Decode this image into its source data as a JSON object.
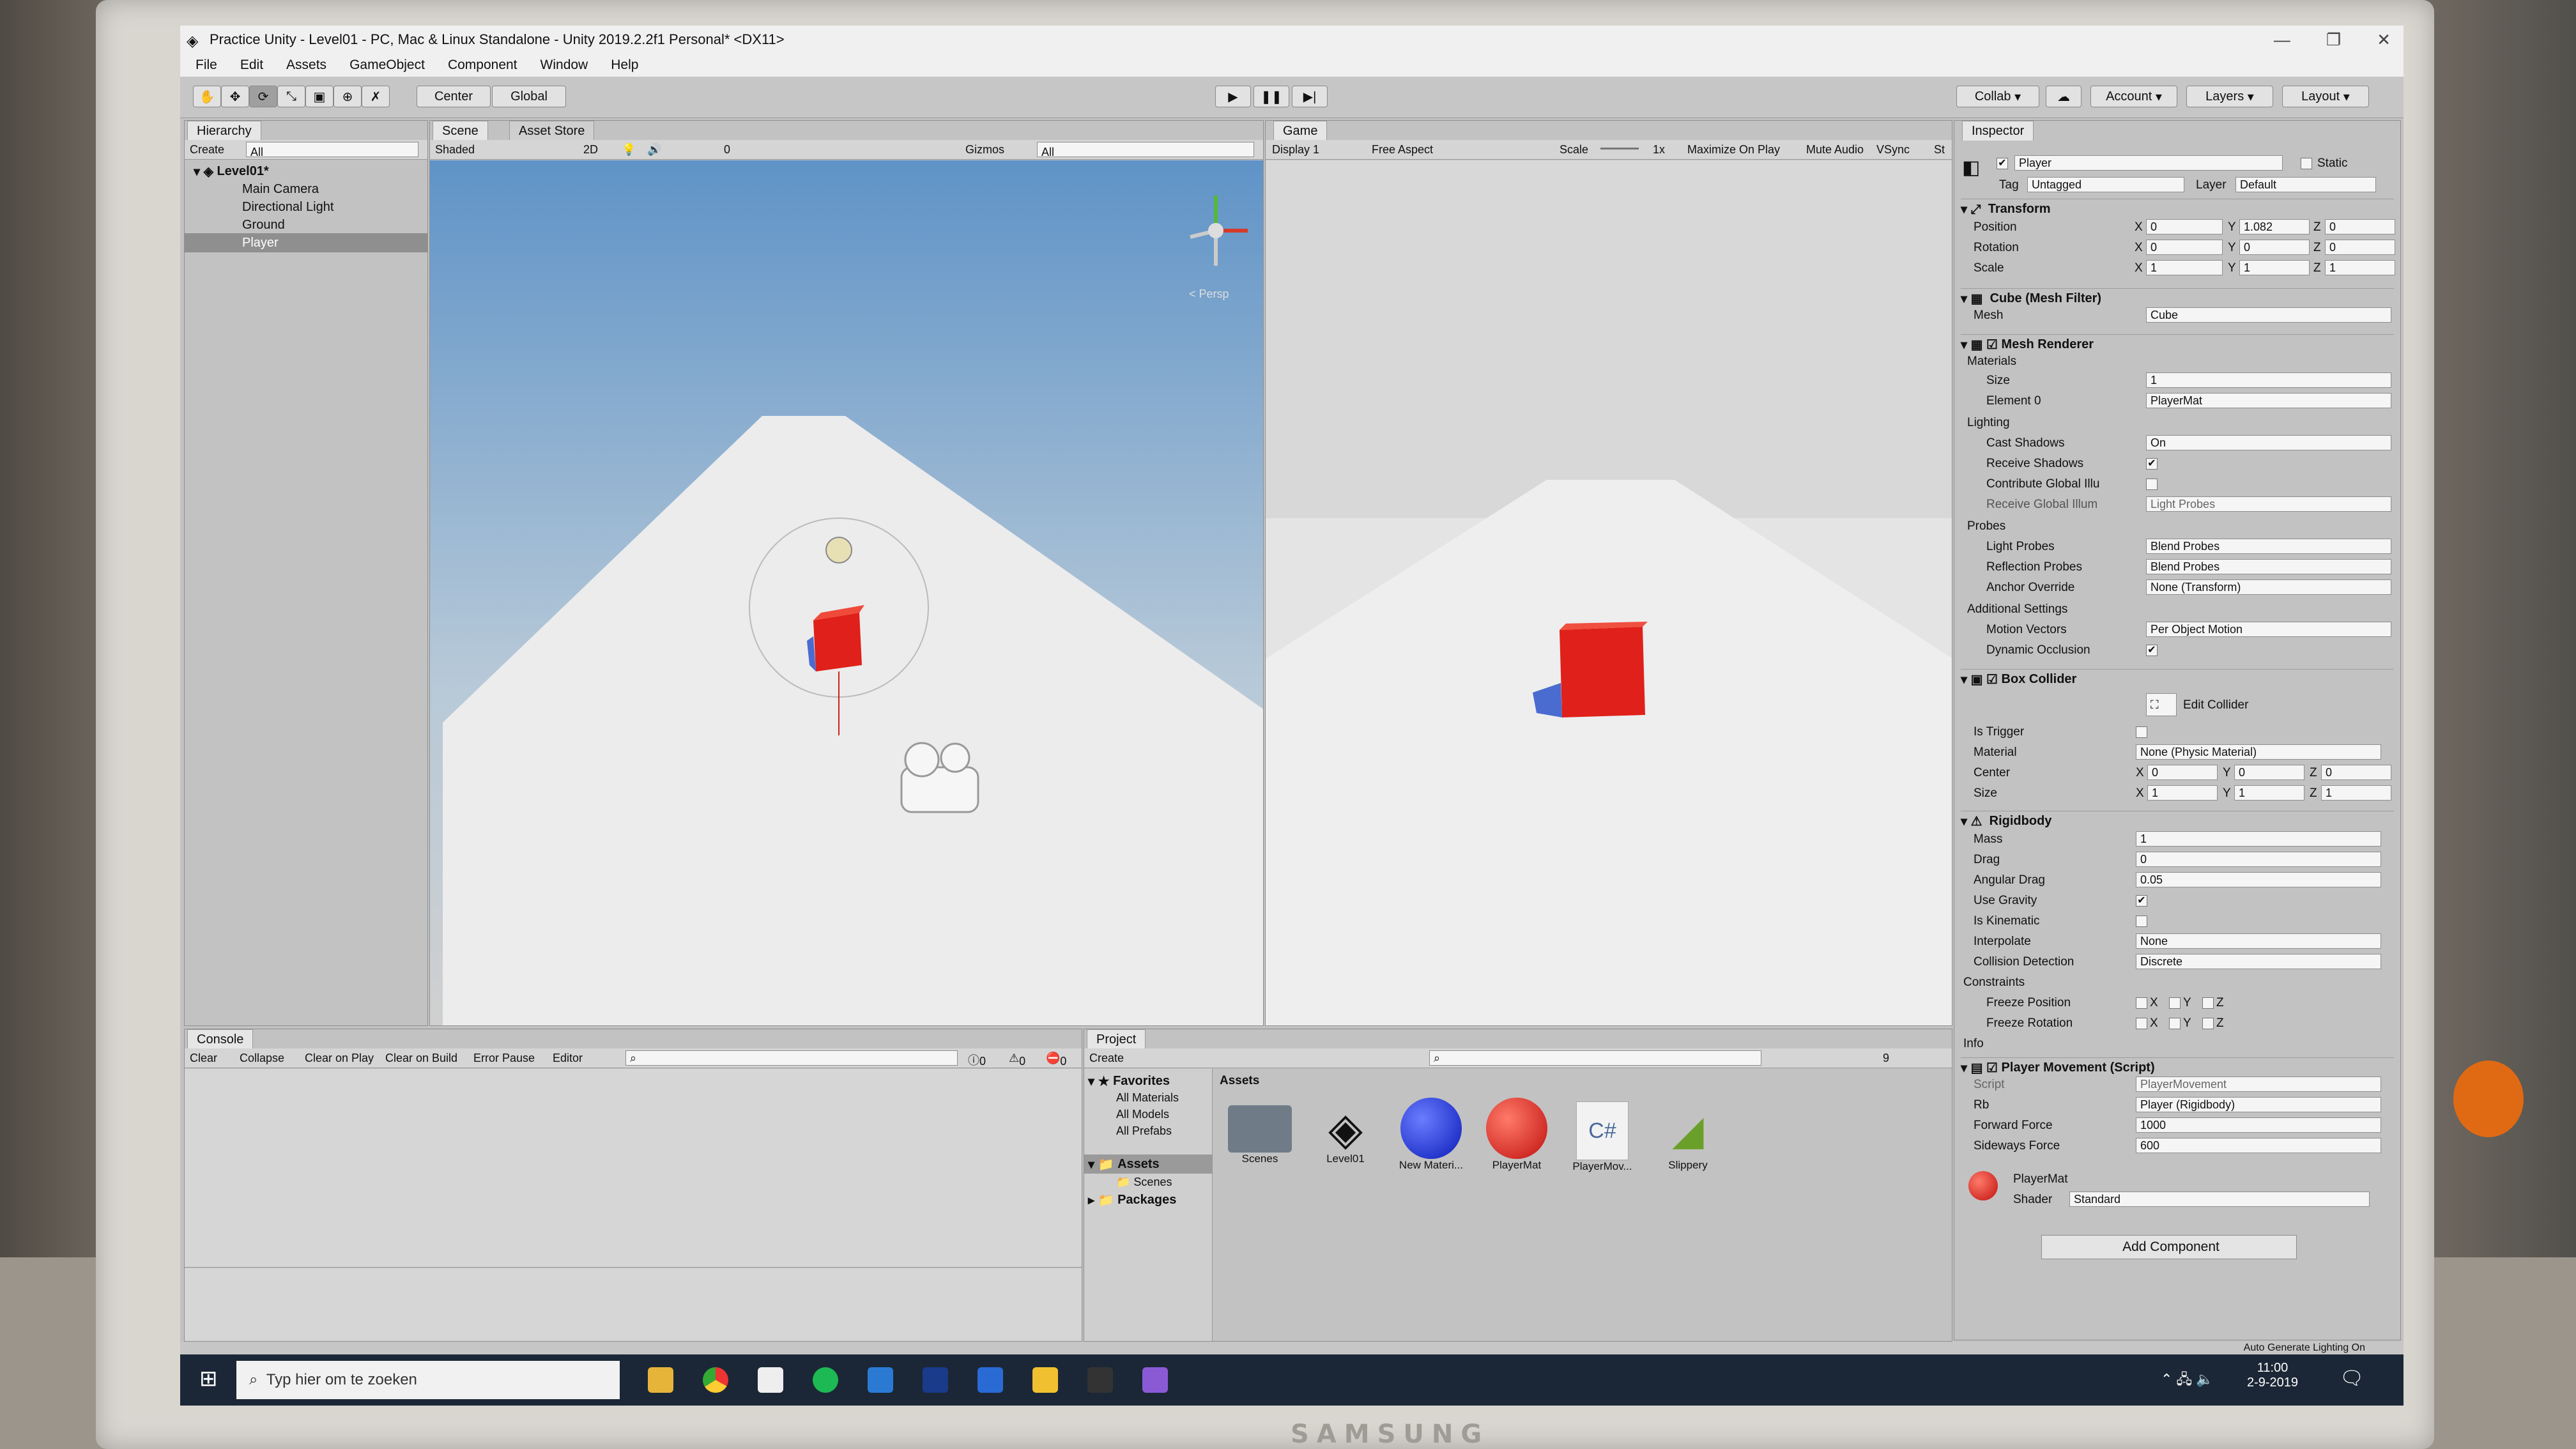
{
  "window": {
    "title": "Practice Unity - Level01 - PC, Mac & Linux Standalone - Unity 2019.2.2f1 Personal* <DX11>"
  },
  "menu": [
    "File",
    "Edit",
    "Assets",
    "GameObject",
    "Component",
    "Window",
    "Help"
  ],
  "toolbar": {
    "pivot": "Center",
    "space": "Global",
    "collab": "Collab",
    "account": "Account",
    "layers": "Layers",
    "layout": "Layout"
  },
  "hierarchy": {
    "tab": "Hierarchy",
    "create": "Create",
    "search_placeholder": "All",
    "scene": "Level01*",
    "items": [
      "Main Camera",
      "Directional Light",
      "Ground",
      "Player"
    ]
  },
  "scene_view": {
    "tab": "Scene",
    "tab2": "Asset Store",
    "shading": "Shaded",
    "mode2d": "2D",
    "gizmos": "Gizmos",
    "search_placeholder": "All",
    "persp": "< Persp",
    "hidden_count": "0"
  },
  "game_view": {
    "tab": "Game",
    "display": "Display 1",
    "aspect": "Free Aspect",
    "scale_label": "Scale",
    "scale_value": "1x",
    "maximize": "Maximize On Play",
    "mute": "Mute Audio",
    "vsync": "VSync",
    "stats": "St"
  },
  "inspector": {
    "tab": "Inspector",
    "object_name": "Player",
    "static_label": "Static",
    "tag_label": "Tag",
    "tag_value": "Untagged",
    "layer_label": "Layer",
    "layer_value": "Default",
    "transform": {
      "title": "Transform",
      "position": {
        "label": "Position",
        "x": "0",
        "y": "1.082",
        "z": "0"
      },
      "rotation": {
        "label": "Rotation",
        "x": "0",
        "y": "0",
        "z": "0"
      },
      "scale": {
        "label": "Scale",
        "x": "1",
        "y": "1",
        "z": "1"
      }
    },
    "mesh_filter": {
      "title": "Cube (Mesh Filter)",
      "mesh_label": "Mesh",
      "mesh_value": "Cube"
    },
    "mesh_renderer": {
      "title": "Mesh Renderer",
      "materials": "Materials",
      "size_label": "Size",
      "size_value": "1",
      "element_label": "Element 0",
      "element_value": "PlayerMat",
      "lighting": "Lighting",
      "cast_label": "Cast Shadows",
      "cast_value": "On",
      "receive_label": "Receive Shadows",
      "contribute_label": "Contribute Global Illu",
      "receive_gi_label": "Receive Global Illum",
      "receive_gi_value": "Light Probes",
      "probes": "Probes",
      "light_probes_label": "Light Probes",
      "light_probes_value": "Blend Probes",
      "reflection_label": "Reflection Probes",
      "reflection_value": "Blend Probes",
      "anchor_label": "Anchor Override",
      "anchor_value": "None (Transform)",
      "additional": "Additional Settings",
      "motion_label": "Motion Vectors",
      "motion_value": "Per Object Motion",
      "occlusion_label": "Dynamic Occlusion"
    },
    "box_collider": {
      "title": "Box Collider",
      "edit": "Edit Collider",
      "trigger_label": "Is Trigger",
      "material_label": "Material",
      "material_value": "None (Physic Material)",
      "center_label": "Center",
      "cx": "0",
      "cy": "0",
      "cz": "0",
      "size_label": "Size",
      "sx": "1",
      "sy": "1",
      "sz": "1"
    },
    "rigidbody": {
      "title": "Rigidbody",
      "mass_label": "Mass",
      "mass": "1",
      "drag_label": "Drag",
      "drag": "0",
      "angular_label": "Angular Drag",
      "angular": "0.05",
      "gravity_label": "Use Gravity",
      "kinematic_label": "Is Kinematic",
      "interpolate_label": "Interpolate",
      "interpolate": "None",
      "collision_label": "Collision Detection",
      "collision": "Discrete",
      "constraints": "Constraints",
      "freeze_pos": "Freeze Position",
      "freeze_rot": "Freeze Rotation",
      "info": "Info",
      "x": "X",
      "y": "Y",
      "z": "Z"
    },
    "player_movement": {
      "title": "Player Movement (Script)",
      "script_label": "Script",
      "script_value": "PlayerMovement",
      "rb_label": "Rb",
      "rb_value": "Player (Rigidbody)",
      "forward_label": "Forward Force",
      "forward_value": "1000",
      "sideways_label": "Sideways Force",
      "sideways_value": "600"
    },
    "material": {
      "name": "PlayerMat",
      "shader_label": "Shader",
      "shader_value": "Standard"
    },
    "add_component": "Add Component"
  },
  "console": {
    "tab": "Console",
    "buttons": [
      "Clear",
      "Collapse",
      "Clear on Play",
      "Clear on Build",
      "Error Pause",
      "Editor"
    ],
    "count_log": "0",
    "count_warn": "0",
    "count_err": "0"
  },
  "project": {
    "tab": "Project",
    "create": "Create",
    "favorites": "Favorites",
    "fav_items": [
      "All Materials",
      "All Models",
      "All Prefabs"
    ],
    "assets_root": "Assets",
    "scenes": "Scenes",
    "packages": "Packages",
    "assets_header": "Assets",
    "assets": [
      "Scenes",
      "Level01",
      "New Materi...",
      "PlayerMat",
      "PlayerMov...",
      "Slippery"
    ],
    "hidden_count": "9"
  },
  "status": {
    "right": "Auto Generate Lighting On"
  },
  "taskbar": {
    "search_placeholder": "Typ hier om te zoeken",
    "time": "11:00",
    "date": "2-9-2019"
  },
  "monitor": {
    "brand": "SAMSUNG"
  },
  "colors": {
    "player_cube": "#e0201a",
    "sky_top": "#7aa6cf",
    "ground": "#ececec"
  }
}
